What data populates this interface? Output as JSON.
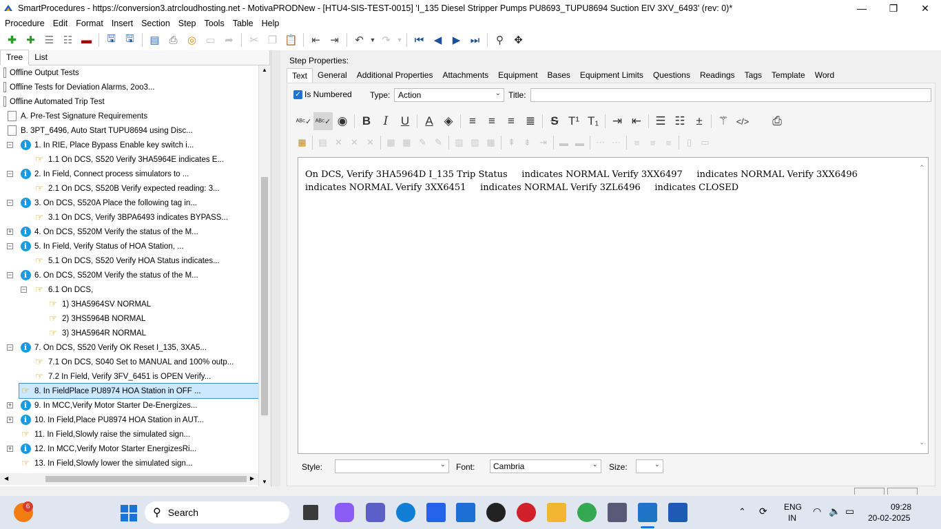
{
  "window": {
    "title": "SmartProcedures - https://conversion3.atrcloudhosting.net - MotivaPRODNew - [HTU4-SIS-TEST-0015] 'I_135 Diesel Stripper Pumps PU8693_TUPU8694 Suction EIV 3XV_6493' (rev: 0)*",
    "minimize": "—",
    "maximize": "❐",
    "close": "✕"
  },
  "menu": [
    "Procedure",
    "Edit",
    "Format",
    "Insert",
    "Section",
    "Step",
    "Tools",
    "Table",
    "Help"
  ],
  "left_tabs": [
    "Tree",
    "List"
  ],
  "tree": [
    {
      "label": "Offline Output Tests",
      "icon": "doc",
      "level": 0
    },
    {
      "label": "Offline Tests for Deviation Alarms, 2oo3...",
      "icon": "doc",
      "level": 0
    },
    {
      "label": "Offline Automated Trip Test",
      "icon": "doc",
      "level": 0
    },
    {
      "label": "A. Pre-Test Signature Requirements",
      "icon": "doc",
      "level": 1
    },
    {
      "label": "B. 3PT_6496, Auto Start TUPU8694 using Disc...",
      "icon": "doc",
      "level": 1
    },
    {
      "label": "1. In RIE, Place Bypass Enable key switch i...",
      "icon": "info",
      "level": 2,
      "exp": "−"
    },
    {
      "label": "1.1 On DCS, S520 Verify 3HA5964E indicates E...",
      "icon": "hand",
      "level": 3
    },
    {
      "label": "2. In Field, Connect process simulators to ...",
      "icon": "info",
      "level": 2,
      "exp": "−"
    },
    {
      "label": "2.1 On DCS, S520B Verify expected reading: 3...",
      "icon": "hand",
      "level": 3
    },
    {
      "label": "3. On DCS, S520A Place the following tag in...",
      "icon": "info",
      "level": 2,
      "exp": "−"
    },
    {
      "label": "3.1 On DCS, Verify 3BPA6493 indicates BYPASS...",
      "icon": "hand",
      "level": 3
    },
    {
      "label": "4. On DCS, S520M Verify the status of the M...",
      "icon": "info",
      "level": 2,
      "exp": "+"
    },
    {
      "label": "5. In Field, Verify Status of HOA Station, ...",
      "icon": "info",
      "level": 2,
      "exp": "−"
    },
    {
      "label": "5.1 On DCS, S520 Verify HOA Status indicates...",
      "icon": "hand",
      "level": 3
    },
    {
      "label": "6. On DCS, S520M Verify the status of the M...",
      "icon": "info",
      "level": 2,
      "exp": "−"
    },
    {
      "label": "6.1 On DCS,",
      "icon": "hand",
      "level": 3,
      "exp": "−"
    },
    {
      "label": "1) 3HA5964SV NORMAL",
      "icon": "hand",
      "level": 4
    },
    {
      "label": "2) 3HS5964B NORMAL",
      "icon": "hand",
      "level": 4
    },
    {
      "label": "3) 3HA5964R NORMAL",
      "icon": "hand",
      "level": 4
    },
    {
      "label": "7. On DCS, S520 Verify OK Reset I_135, 3XA5...",
      "icon": "info",
      "level": 2,
      "exp": "−"
    },
    {
      "label": "7.1 On DCS, S040 Set to MANUAL and 100% outp...",
      "icon": "hand",
      "level": 3
    },
    {
      "label": "7.2 In Field, Verify 3FV_6451 is OPEN Verify...",
      "icon": "hand",
      "level": 3
    },
    {
      "label": "8. In FieldPlace PU8974 HOA Station in OFF ...",
      "icon": "hand",
      "level": 2,
      "selected": true
    },
    {
      "label": "9. In MCC,Verify Motor Starter De-Energizes...",
      "icon": "info",
      "level": 2,
      "exp": "+"
    },
    {
      "label": "10. In Field,Place PU8974 HOA Station in AUT...",
      "icon": "info",
      "level": 2,
      "exp": "+"
    },
    {
      "label": "11. In Field,Slowly raise the simulated sign...",
      "icon": "hand",
      "level": 2
    },
    {
      "label": "12. In MCC,Verify Motor Starter EnergizesRi...",
      "icon": "info",
      "level": 2,
      "exp": "+"
    },
    {
      "label": "13. In Field,Slowly lower the simulated sign...",
      "icon": "hand",
      "level": 2
    }
  ],
  "step_properties": {
    "heading": "Step Properties:",
    "tabs": [
      "Text",
      "General",
      "Additional Properties",
      "Attachments",
      "Equipment",
      "Bases",
      "Equipment Limits",
      "Questions",
      "Readings",
      "Tags",
      "Template",
      "Word"
    ],
    "is_numbered_label": "Is Numbered",
    "is_numbered": true,
    "type_label": "Type:",
    "type_value": "Action",
    "title_label": "Title:",
    "title_value": "",
    "editor_text": "On DCS, Verify 3HA5964D I_135 Trip Status     indicates NORMAL Verify 3XX6497     indicates NORMAL Verify 3XX6496\nindicates NORMAL Verify 3XX6451     indicates NORMAL Verify 3ZL6496     indicates CLOSED",
    "style_label": "Style:",
    "style_value": "",
    "font_label": "Font:",
    "font_value": "Cambria",
    "size_label": "Size:",
    "size_value": ""
  },
  "taskbar": {
    "search_placeholder": "Search",
    "badge_count": "6",
    "lang_top": "ENG",
    "lang_bottom": "IN",
    "time": "09:28",
    "date": "20-02-2025"
  }
}
